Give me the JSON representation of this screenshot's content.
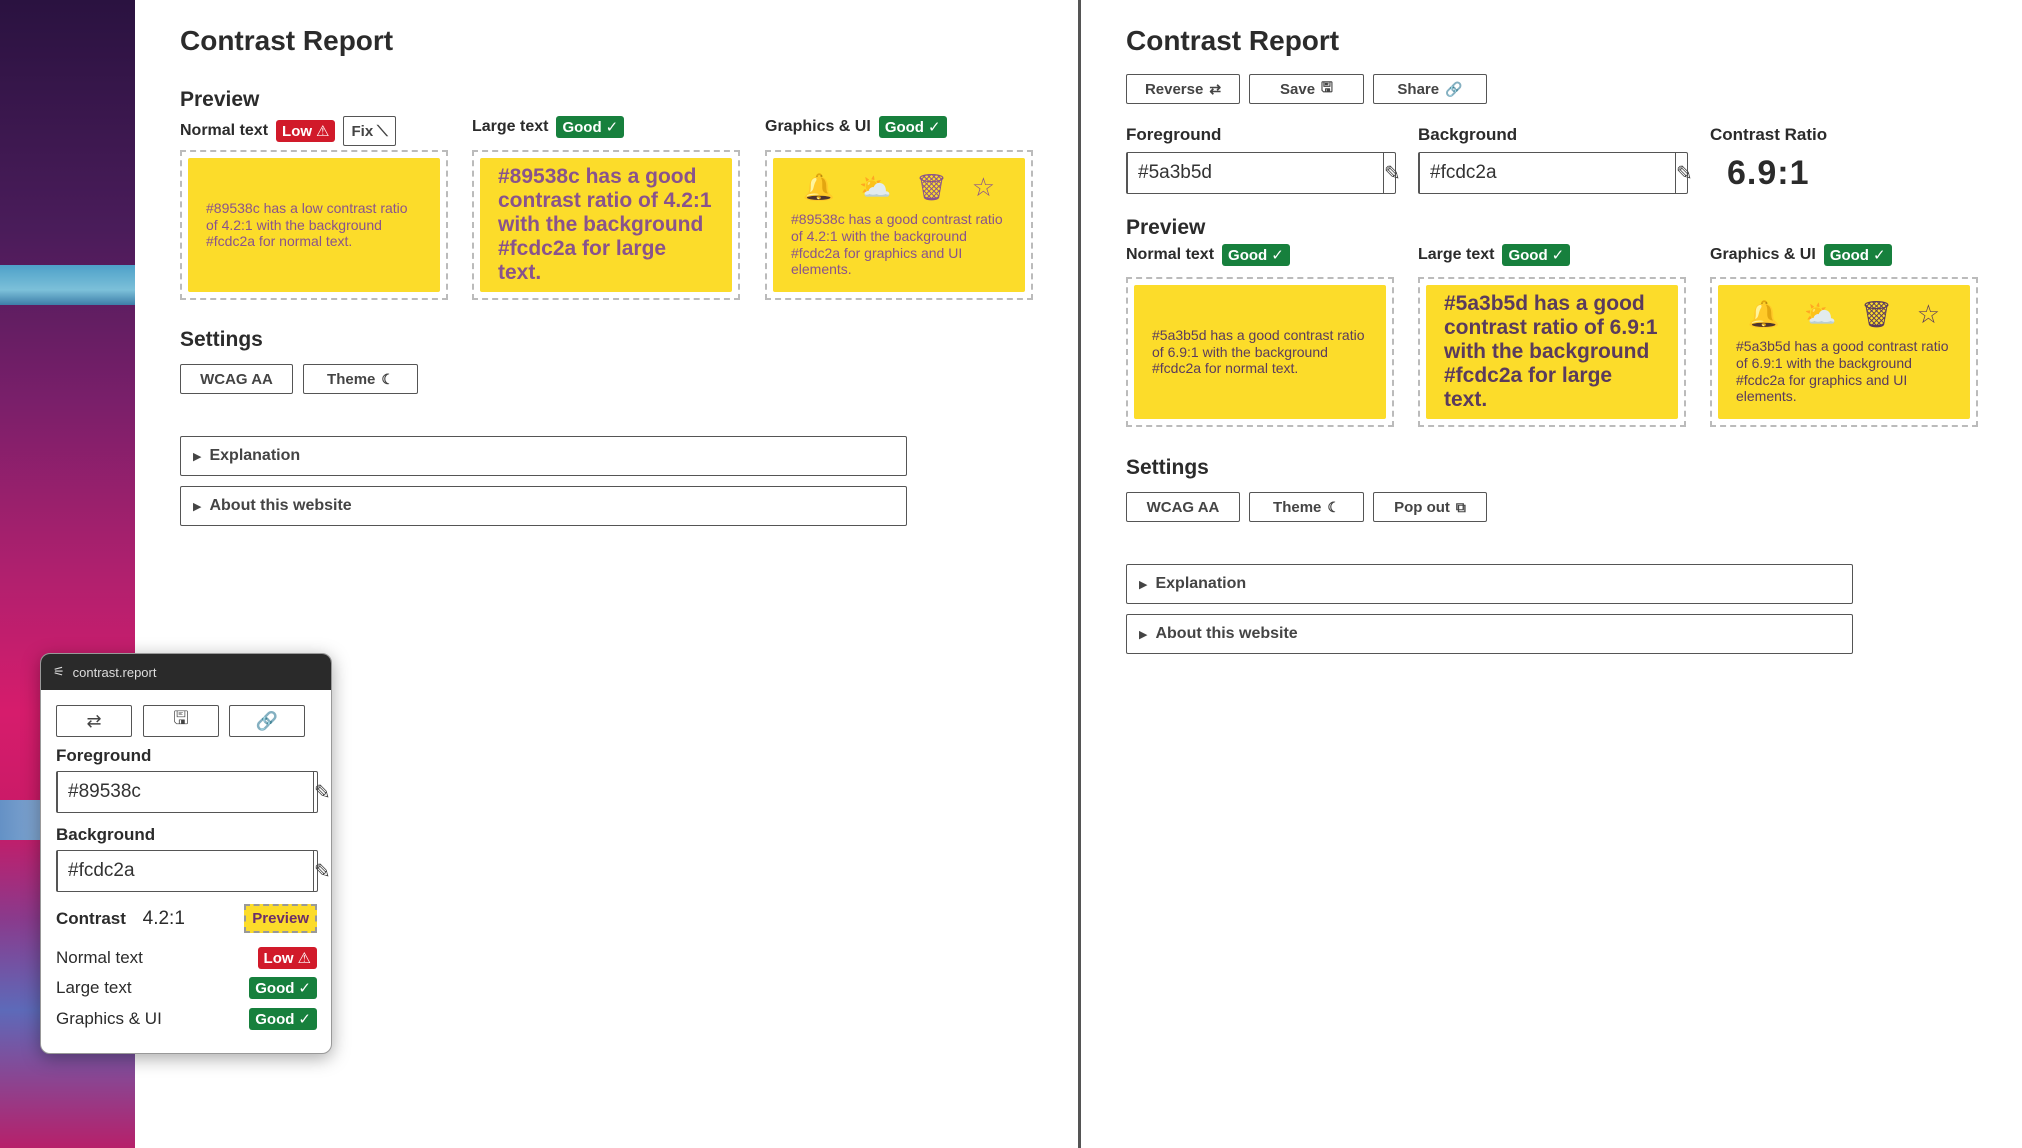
{
  "left": {
    "title": "Contrast Report",
    "preview_heading": "Preview",
    "normal": {
      "label": "Normal text",
      "badge": "Low",
      "badge_icon": "⚠",
      "fix_label": "Fix",
      "fix_icon": "⟍"
    },
    "large": {
      "label": "Large text",
      "badge": "Good",
      "badge_icon": "✓"
    },
    "graphics": {
      "label": "Graphics & UI",
      "badge": "Good",
      "badge_icon": "✓"
    },
    "cards": {
      "normal_text": "#89538c has a low contrast ratio of 4.2:1 with the background #fcdc2a for normal text.",
      "large_text": "#89538c has a good contrast ratio of 4.2:1 with the background #fcdc2a for large text.",
      "graphics_text": "#89538c has a good contrast ratio of 4.2:1 with the background #fcdc2a for graphics and UI elements."
    },
    "settings_heading": "Settings",
    "settings": {
      "wcag": "WCAG AA",
      "theme": "Theme",
      "theme_icon": "☾"
    },
    "explanation": "Explanation",
    "about": "About this website",
    "fg_color": "#89538c",
    "bg_color": "#fcdc2a"
  },
  "right": {
    "title": "Contrast Report",
    "toolbar": {
      "reverse": "Reverse",
      "reverse_icon": "⇄",
      "save": "Save",
      "save_icon": "🖫",
      "share": "Share",
      "share_icon": "🔗"
    },
    "foreground_label": "Foreground",
    "foreground_value": "#5a3b5d",
    "background_label": "Background",
    "background_value": "#fcdc2a",
    "ratio_label": "Contrast Ratio",
    "ratio_value": "6.9:1",
    "preview_heading": "Preview",
    "normal": {
      "label": "Normal text",
      "badge": "Good",
      "badge_icon": "✓"
    },
    "large": {
      "label": "Large text",
      "badge": "Good",
      "badge_icon": "✓"
    },
    "graphics": {
      "label": "Graphics & UI",
      "badge": "Good",
      "badge_icon": "✓"
    },
    "cards": {
      "normal_text": "#5a3b5d has a good contrast ratio of 6.9:1 with the background #fcdc2a for normal text.",
      "large_text": "#5a3b5d has a good contrast ratio of 6.9:1 with the background #fcdc2a for large text.",
      "graphics_text": "#5a3b5d has a good contrast ratio of 6.9:1 with the background #fcdc2a for graphics and UI elements."
    },
    "settings_heading": "Settings",
    "settings": {
      "wcag": "WCAG AA",
      "theme": "Theme",
      "theme_icon": "☾",
      "popout": "Pop out",
      "popout_icon": "⧉"
    },
    "explanation": "Explanation",
    "about": "About this website",
    "fg_color": "#5a3b5d",
    "bg_color": "#fcdc2a"
  },
  "popup": {
    "window_title": "contrast.report",
    "reverse_icon": "⇄",
    "save_icon": "🖫",
    "share_icon": "🔗",
    "foreground_label": "Foreground",
    "foreground_value": "#89538c",
    "background_label": "Background",
    "background_value": "#fcdc2a",
    "contrast_label": "Contrast",
    "contrast_value": "4.2:1",
    "preview_label": "Preview",
    "rows": [
      {
        "label": "Normal text",
        "badge": "Low",
        "icon": "⚠"
      },
      {
        "label": "Large text",
        "badge": "Good",
        "icon": "✓"
      },
      {
        "label": "Graphics & UI",
        "badge": "Good",
        "icon": "✓"
      }
    ]
  },
  "icons": {
    "bell": "🔔",
    "weather": "⛅",
    "trash": "🗑",
    "star": "☆",
    "eyedropper": "✎",
    "triangle": "▶"
  }
}
